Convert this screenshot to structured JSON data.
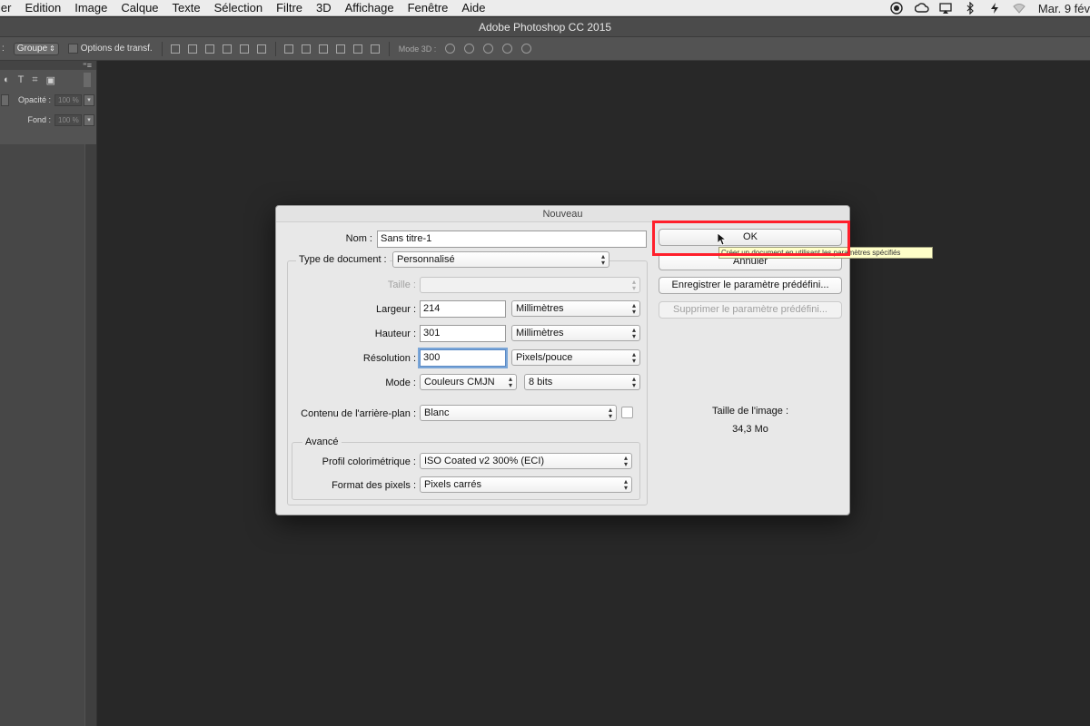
{
  "menubar": {
    "items": [
      "ier",
      "Edition",
      "Image",
      "Calque",
      "Texte",
      "Sélection",
      "Filtre",
      "3D",
      "Affichage",
      "Fenêtre",
      "Aide"
    ],
    "clock": "Mar. 9 fév"
  },
  "app": {
    "title": "Adobe Photoshop CC 2015"
  },
  "optionsbar": {
    "group_value": "Groupe",
    "transform_label": "Options de transf.",
    "mode3d_label": "Mode 3D :"
  },
  "layers_panel": {
    "opacity_label": "Opacité :",
    "opacity_value": "100 %",
    "fill_label": "Fond :",
    "fill_value": "100 %"
  },
  "dialog": {
    "title": "Nouveau",
    "name_label": "Nom :",
    "name_value": "Sans titre-1",
    "doctype_label": "Type de document :",
    "doctype_value": "Personnalisé",
    "size_label": "Taille :",
    "size_value": "",
    "width_label": "Largeur :",
    "width_value": "214",
    "width_unit": "Millimètres",
    "height_label": "Hauteur :",
    "height_value": "301",
    "height_unit": "Millimètres",
    "resolution_label": "Résolution :",
    "resolution_value": "300",
    "resolution_unit": "Pixels/pouce",
    "mode_label": "Mode :",
    "mode_value": "Couleurs CMJN",
    "bits_value": "8 bits",
    "background_label": "Contenu de l'arrière-plan :",
    "background_value": "Blanc",
    "advanced_legend": "Avancé",
    "profile_label": "Profil colorimétrique :",
    "profile_value": "ISO Coated v2 300% (ECI)",
    "pixel_aspect_label": "Format des pixels :",
    "pixel_aspect_value": "Pixels carrés",
    "ok_label": "OK",
    "cancel_label": "Annuler",
    "save_preset_label": "Enregistrer le paramètre prédéfini...",
    "delete_preset_label": "Supprimer le paramètre prédéfini...",
    "image_size_label": "Taille de l'image :",
    "image_size_value": "34,3 Mo",
    "tooltip": "Créer un document en utilisant les paramètres spécifiés"
  },
  "colors": {
    "highlight": "#ff1f2b",
    "workspace": "#282828"
  }
}
